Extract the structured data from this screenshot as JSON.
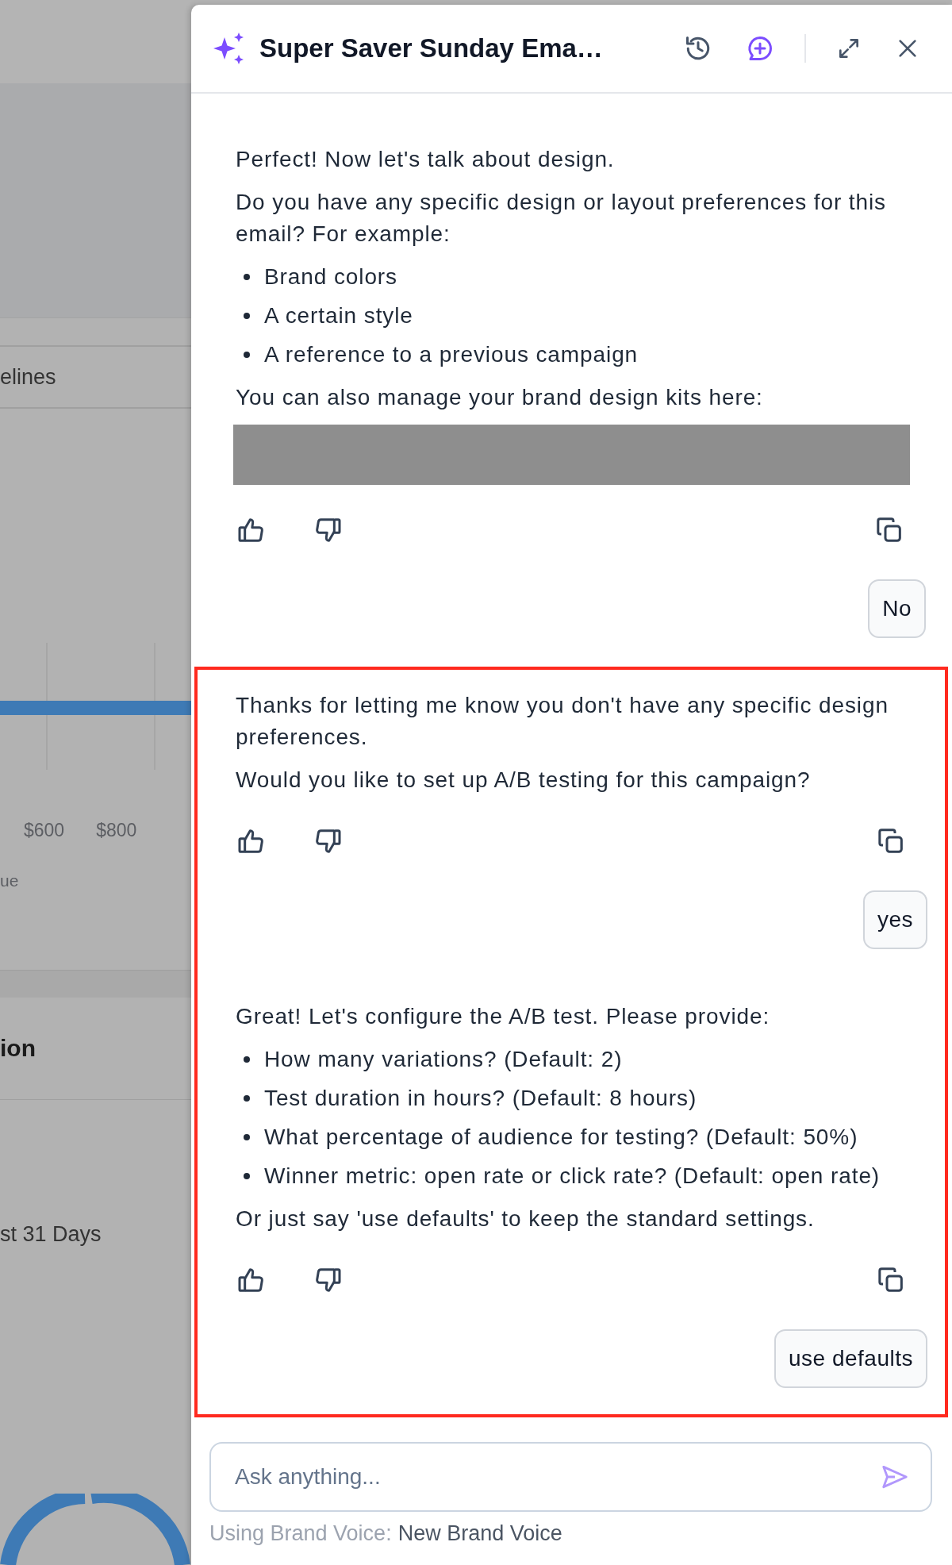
{
  "background": {
    "row_label": "elines",
    "axis_labels": [
      "$600",
      "$800"
    ],
    "axis_title": "ue",
    "section_title": "ion",
    "period_label": "st 31 Days"
  },
  "panel": {
    "title": "Super Saver Sunday Ema…"
  },
  "messages": [
    {
      "kind": "bot",
      "highlighted": false,
      "blocks": [
        {
          "kind": "paragraph",
          "text": "Perfect! Now let's talk about design."
        },
        {
          "kind": "paragraph",
          "text": "Do you have any specific design or layout preferences for this email? For example:"
        },
        {
          "kind": "bullets",
          "items": [
            "Brand colors",
            "A certain style",
            "A reference to a previous campaign"
          ]
        },
        {
          "kind": "paragraph",
          "text": "You can also manage your brand design kits here:"
        },
        {
          "kind": "redacted"
        }
      ]
    },
    {
      "kind": "user",
      "highlighted": false,
      "text": "No"
    },
    {
      "kind": "bot",
      "highlighted": true,
      "blocks": [
        {
          "kind": "paragraph",
          "text": "Thanks for letting me know you don't have any specific design preferences."
        },
        {
          "kind": "paragraph",
          "text": "Would you like to set up A/B testing for this campaign?"
        }
      ]
    },
    {
      "kind": "user",
      "highlighted": true,
      "text": "yes"
    },
    {
      "kind": "bot",
      "highlighted": true,
      "blocks": [
        {
          "kind": "paragraph",
          "text": "Great! Let's configure the A/B test. Please provide:"
        },
        {
          "kind": "bullets",
          "items": [
            "How many variations? (Default: 2)",
            "Test duration in hours? (Default: 8 hours)",
            "What percentage of audience for testing? (Default: 50%)",
            "Winner metric: open rate or click rate? (Default: open rate)"
          ]
        },
        {
          "kind": "paragraph",
          "text": "Or just say 'use defaults' to keep the standard settings."
        }
      ]
    },
    {
      "kind": "user",
      "highlighted": true,
      "text": "use defaults"
    }
  ],
  "input": {
    "placeholder": "Ask anything..."
  },
  "brand_voice": {
    "label": "Using Brand Voice:",
    "value": "New Brand Voice"
  }
}
